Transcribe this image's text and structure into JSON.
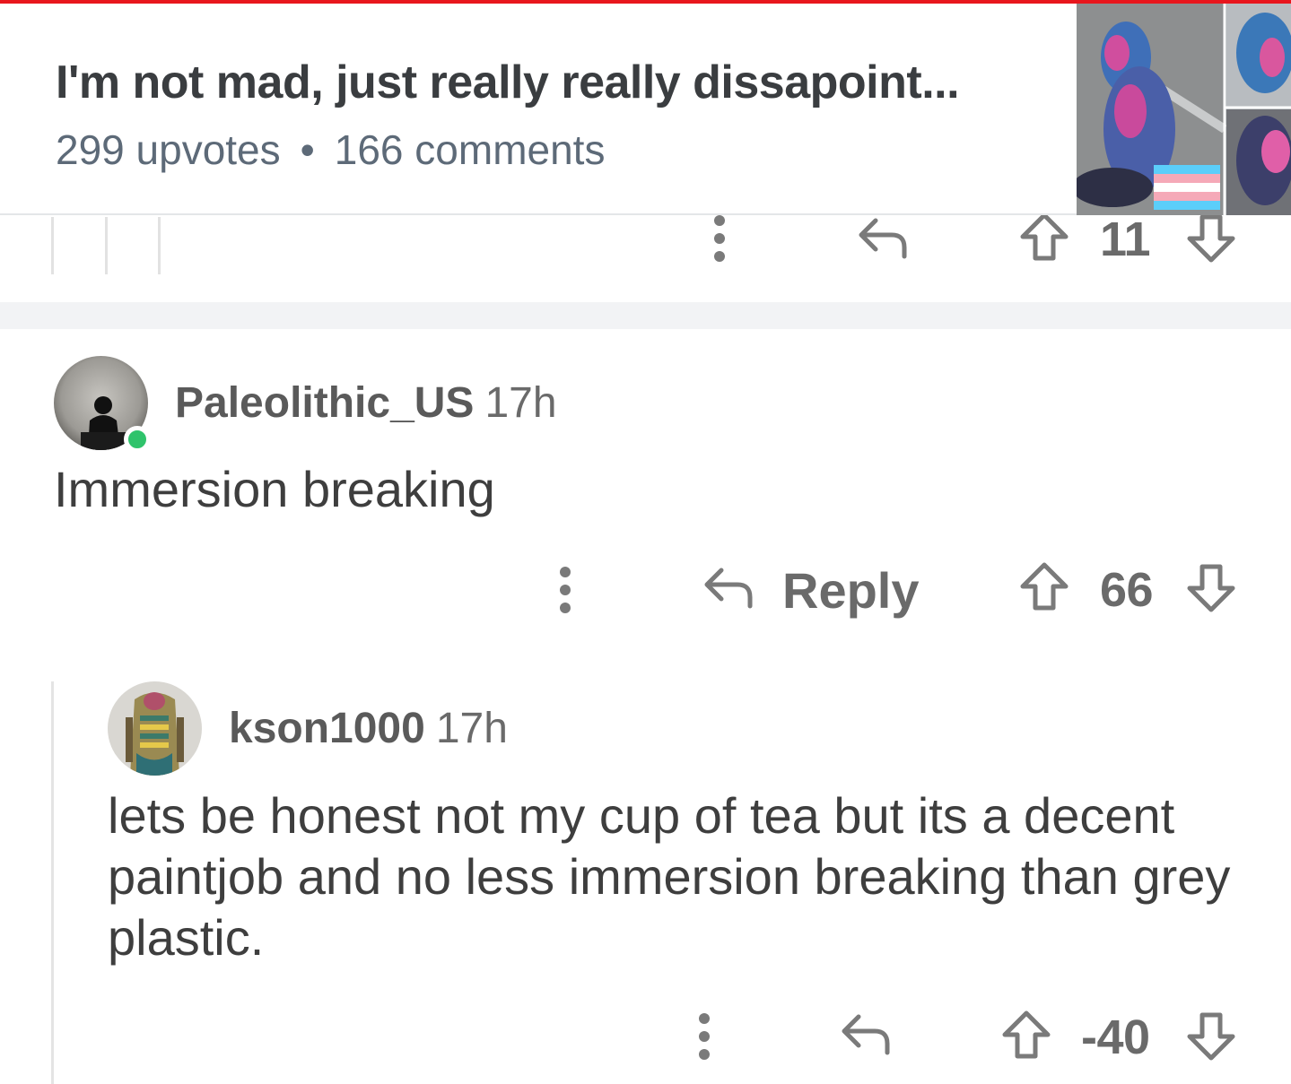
{
  "post": {
    "title": "I'm not mad, just really really dissapoint...",
    "upvotes": "299 upvotes",
    "separator": "•",
    "comments": "166 comments"
  },
  "previous_comment": {
    "score": "11"
  },
  "comments": [
    {
      "username": "Paleolithic_US",
      "time": "17h",
      "body": "Immersion breaking",
      "reply_label": "Reply",
      "score": "66"
    },
    {
      "username": "kson1000",
      "time": "17h",
      "body": "lets be honest not my cup of tea but its a decent paintjob and no less immersion breaking than grey plastic.",
      "score": "-40"
    }
  ],
  "colors": {
    "accent": "#e8161d",
    "online": "#2fc36b",
    "icon_gray": "#7a7a7a"
  },
  "icons": [
    "more-icon",
    "reply-icon",
    "upvote-icon",
    "downvote-icon"
  ]
}
